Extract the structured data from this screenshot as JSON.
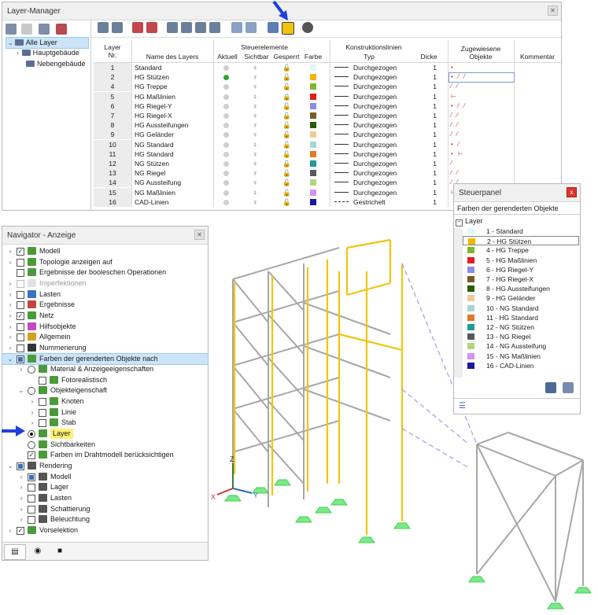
{
  "layer_manager": {
    "title": "Layer-Manager",
    "tree": [
      {
        "label": "Alle Layer",
        "selected": true
      },
      {
        "label": "Hauptgebäude"
      },
      {
        "label": "Nebengebäude"
      }
    ],
    "headers": {
      "nr_line1": "Layer",
      "nr_line2": "Nr.",
      "name": "Name des Layers",
      "steuer_group": "Steuerelemente",
      "aktuell": "Aktuell",
      "sichtbar": "Sichtbar",
      "gesperrt": "Gesperrt",
      "farbe": "Farbe",
      "konstr_group": "Konstruktionslinien",
      "typ": "Typ",
      "dicke": "Dicke",
      "zug_line1": "Zugewiesene",
      "zug_line2": "Objekte",
      "kommentar": "Kommentar"
    },
    "rows": [
      {
        "nr": "1",
        "name": "Standard",
        "color": "#e0f7f7",
        "locked": false,
        "current": false,
        "typ": "Durchgezogen",
        "dicke": "1",
        "obj": "•"
      },
      {
        "nr": "2",
        "name": "HG Stützen",
        "color": "#f2b705",
        "locked": false,
        "current": true,
        "typ": "Durchgezogen",
        "dicke": "1",
        "obj": "• ⁄ ⁄"
      },
      {
        "nr": "4",
        "name": "HG Treppe",
        "color": "#7db928",
        "locked": false,
        "current": false,
        "typ": "Durchgezogen",
        "dicke": "1",
        "obj": "⁄ ⁄"
      },
      {
        "nr": "5",
        "name": "HG Maßlinien",
        "color": "#e01e1e",
        "locked": true,
        "current": false,
        "typ": "Durchgezogen",
        "dicke": "1",
        "obj": "⊢"
      },
      {
        "nr": "6",
        "name": "HG Riegel-Y",
        "color": "#8c8ce6",
        "locked": false,
        "current": false,
        "typ": "Durchgezogen",
        "dicke": "1",
        "obj": "• ⁄ ⁄"
      },
      {
        "nr": "7",
        "name": "HG Riegel-X",
        "color": "#7a5a2a",
        "locked": false,
        "current": false,
        "typ": "Durchgezogen",
        "dicke": "1",
        "obj": "⁄ ⁄"
      },
      {
        "nr": "8",
        "name": "HG Aussteifungen",
        "color": "#2c5a0c",
        "locked": false,
        "current": false,
        "typ": "Durchgezogen",
        "dicke": "1",
        "obj": "⁄ ⁄"
      },
      {
        "nr": "9",
        "name": "HG Geländer",
        "color": "#f0c898",
        "locked": false,
        "current": false,
        "typ": "Durchgezogen",
        "dicke": "1",
        "obj": "⁄ ⁄"
      },
      {
        "nr": "10",
        "name": "NG Standard",
        "color": "#a8d4d4",
        "locked": false,
        "current": false,
        "typ": "Durchgezogen",
        "dicke": "1",
        "obj": "• ⁄"
      },
      {
        "nr": "11",
        "name": "HG Standard",
        "color": "#e07a28",
        "locked": false,
        "current": false,
        "typ": "Durchgezogen",
        "dicke": "1",
        "obj": "• ⊢"
      },
      {
        "nr": "12",
        "name": "NG Stützen",
        "color": "#1e9a9a",
        "locked": false,
        "current": false,
        "typ": "Durchgezogen",
        "dicke": "1",
        "obj": "⁄"
      },
      {
        "nr": "13",
        "name": "NG Riegel",
        "color": "#555a60",
        "locked": false,
        "current": false,
        "typ": "Durchgezogen",
        "dicke": "1",
        "obj": "⁄ ⁄"
      },
      {
        "nr": "14",
        "name": "NG Aussteifung",
        "color": "#b4d47c",
        "locked": false,
        "current": false,
        "typ": "Durchgezogen",
        "dicke": "1",
        "obj": "⁄ ⁄"
      },
      {
        "nr": "15",
        "name": "NG Maßlinien",
        "color": "#d890f0",
        "locked": false,
        "current": false,
        "typ": "Durchgezogen",
        "dicke": "1",
        "obj": "⊢"
      },
      {
        "nr": "16",
        "name": "CAD-Linien",
        "color": "#1e14a0",
        "locked": false,
        "current": false,
        "typ": "Gestrichelt",
        "dicke": "1",
        "obj": ""
      }
    ]
  },
  "navigator": {
    "title": "Navigator - Anzeige",
    "items": [
      {
        "label": "Modell",
        "level": 0,
        "chev": "›",
        "ctrl": "check",
        "state": "checked",
        "icon": "#4a9a3a"
      },
      {
        "label": "Topologie anzeigen auf",
        "level": 0,
        "chev": "›",
        "ctrl": "check",
        "state": "empty",
        "icon": "#4a9a3a"
      },
      {
        "label": "Ergebnisse der booleschen Operationen",
        "level": 0,
        "chev": "",
        "ctrl": "check",
        "state": "empty",
        "icon": "#4a9a3a"
      },
      {
        "label": "Imperfektionen",
        "level": 0,
        "chev": "›",
        "ctrl": "check",
        "state": "disabled",
        "icon": "#b7b7b7",
        "disabled": true
      },
      {
        "label": "Lasten",
        "level": 0,
        "chev": "›",
        "ctrl": "check",
        "state": "empty",
        "icon": "#3a74c4"
      },
      {
        "label": "Ergebnisse",
        "level": 0,
        "chev": "›",
        "ctrl": "check",
        "state": "empty",
        "icon": "#c4463a"
      },
      {
        "label": "Netz",
        "level": 0,
        "chev": "›",
        "ctrl": "check",
        "state": "checked",
        "icon": "#4a9a3a"
      },
      {
        "label": "Hilfsobjekte",
        "level": 0,
        "chev": "›",
        "ctrl": "check",
        "state": "empty",
        "icon": "#c44ac4"
      },
      {
        "label": "Allgemein",
        "level": 0,
        "chev": "›",
        "ctrl": "check",
        "state": "empty",
        "icon": "#d4a020"
      },
      {
        "label": "Nummerierung",
        "level": 0,
        "chev": "›",
        "ctrl": "check",
        "state": "empty",
        "icon": "#333333"
      },
      {
        "label": "Farben der gerenderten Objekte nach",
        "level": 0,
        "chev": "⌄",
        "ctrl": "check",
        "state": "part",
        "icon": "#4a9a3a",
        "highlight": true
      },
      {
        "label": "Material & Anzeigeeigenschaften",
        "level": 1,
        "chev": "›",
        "ctrl": "radio",
        "state": "off",
        "icon": "#4a9a3a"
      },
      {
        "label": "Fotorealistisch",
        "level": 2,
        "chev": "",
        "ctrl": "check",
        "state": "empty",
        "icon": "#4a9a3a"
      },
      {
        "label": "Objekteigenschaft",
        "level": 1,
        "chev": "⌄",
        "ctrl": "radio",
        "state": "off",
        "icon": "#4a9a3a"
      },
      {
        "label": "Knoten",
        "level": 2,
        "chev": "›",
        "ctrl": "check",
        "state": "empty",
        "icon": "#4a9a3a"
      },
      {
        "label": "Linie",
        "level": 2,
        "chev": "›",
        "ctrl": "check",
        "state": "empty",
        "icon": "#4a9a3a"
      },
      {
        "label": "Stab",
        "level": 2,
        "chev": "›",
        "ctrl": "check",
        "state": "empty",
        "icon": "#4a9a3a"
      },
      {
        "label": "Layer",
        "level": 1,
        "chev": "",
        "ctrl": "radio",
        "state": "on",
        "icon": "#4a9a3a",
        "yellow": true
      },
      {
        "label": "Sichtbarkeiten",
        "level": 1,
        "chev": "",
        "ctrl": "radio",
        "state": "off",
        "icon": "#4a9a3a"
      },
      {
        "label": "Farben im Drahtmodell berücksichtigen",
        "level": 1,
        "chev": "",
        "ctrl": "check",
        "state": "checked",
        "icon": "#4a9a3a"
      },
      {
        "label": "Rendering",
        "level": 0,
        "chev": "⌄",
        "ctrl": "check",
        "state": "part",
        "icon": "#555555"
      },
      {
        "label": "Modell",
        "level": 1,
        "chev": "›",
        "ctrl": "check",
        "state": "part",
        "icon": "#555555"
      },
      {
        "label": "Lager",
        "level": 1,
        "chev": "›",
        "ctrl": "check",
        "state": "empty",
        "icon": "#555555"
      },
      {
        "label": "Lasten",
        "level": 1,
        "chev": "›",
        "ctrl": "check",
        "state": "empty",
        "icon": "#555555"
      },
      {
        "label": "Schattierung",
        "level": 1,
        "chev": "›",
        "ctrl": "check",
        "state": "empty",
        "icon": "#555555"
      },
      {
        "label": "Beleuchtung",
        "level": 1,
        "chev": "›",
        "ctrl": "check",
        "state": "empty",
        "icon": "#555555"
      },
      {
        "label": "Vorselektion",
        "level": 0,
        "chev": "›",
        "ctrl": "check",
        "state": "checked",
        "icon": "#4a9a3a"
      }
    ]
  },
  "steuerpanel": {
    "title": "Steuerpanel",
    "close": "x",
    "subtitle": "Farben der gerenderten Objekte",
    "group": "Layer",
    "items": [
      {
        "label": "1 - Standard",
        "color": "#e0f7f7"
      },
      {
        "label": "2 - HG Stützen",
        "color": "#f2b705",
        "selected": true
      },
      {
        "label": "4 - HG Treppe",
        "color": "#7db928"
      },
      {
        "label": "5 - HG Maßlinien",
        "color": "#e01e1e"
      },
      {
        "label": "6 - HG Riegel-Y",
        "color": "#8c8ce6"
      },
      {
        "label": "7 - HG Riegel-X",
        "color": "#7a5a2a"
      },
      {
        "label": "8 - HG Aussteifungen",
        "color": "#2c5a0c"
      },
      {
        "label": "9 - HG Geländer",
        "color": "#f0c898"
      },
      {
        "label": "10 - NG Standard",
        "color": "#a8d4d4"
      },
      {
        "label": "11 - HG Standard",
        "color": "#e07a28"
      },
      {
        "label": "12 - NG Stützen",
        "color": "#1e9a9a"
      },
      {
        "label": "13 - NG Riegel",
        "color": "#555a60"
      },
      {
        "label": "14 - NG Aussteifung",
        "color": "#b4d47c"
      },
      {
        "label": "15 - NG Maßlinien",
        "color": "#d890f0"
      },
      {
        "label": "16 - CAD-Linien",
        "color": "#1e14a0"
      }
    ]
  },
  "viewport": {
    "axis_x": "X",
    "axis_y": "Y",
    "axis_z": "Z"
  },
  "colors": {
    "accent_yellow": "#f2c40f",
    "arrow_blue": "#1f3fdc",
    "support_green": "#3ad24a",
    "member_gray": "#a7a7a7"
  }
}
